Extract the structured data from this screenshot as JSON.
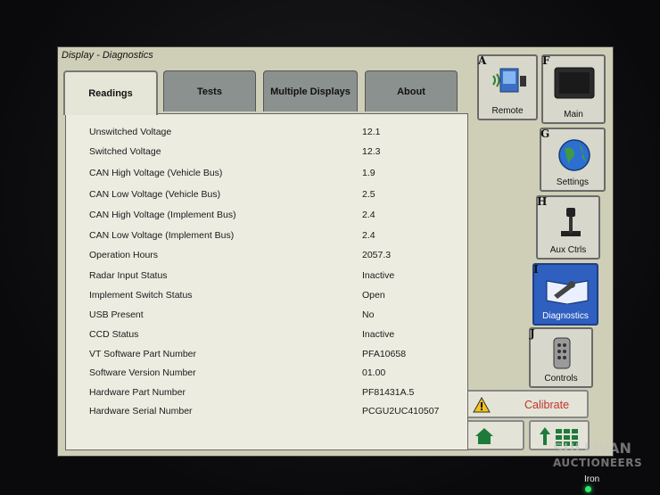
{
  "window": {
    "title": "Display - Diagnostics"
  },
  "tabs": [
    {
      "label": "Readings",
      "active": true
    },
    {
      "label": "Tests",
      "active": false
    },
    {
      "label": "Multiple Displays",
      "active": false
    },
    {
      "label": "About",
      "active": false
    }
  ],
  "readings": [
    {
      "label": "Unswitched Voltage",
      "value": "12.1"
    },
    {
      "label": "Switched Voltage",
      "value": "12.3"
    },
    {
      "label": "CAN High Voltage (Vehicle Bus)",
      "value": "1.9"
    },
    {
      "label": "CAN Low Voltage (Vehicle Bus)",
      "value": "2.5"
    },
    {
      "label": "CAN High Voltage (Implement Bus)",
      "value": "2.4"
    },
    {
      "label": "CAN Low Voltage (Implement Bus)",
      "value": "2.4"
    },
    {
      "label": "Operation Hours",
      "value": "2057.3"
    },
    {
      "label": "Radar Input Status",
      "value": "Inactive"
    },
    {
      "label": "Implement Switch Status",
      "value": "Open"
    },
    {
      "label": "USB Present",
      "value": "No"
    },
    {
      "label": "CCD Status",
      "value": "Inactive"
    },
    {
      "label": "VT Software Part Number",
      "value": "PFA10658"
    },
    {
      "label": "Software Version Number",
      "value": "01.00"
    },
    {
      "label": "Hardware Part Number",
      "value": "PF81431A.5"
    },
    {
      "label": "Hardware Serial Number",
      "value": "PCGU2UC410507"
    }
  ],
  "side_buttons": {
    "remote": {
      "key": "A",
      "label": "Remote",
      "icon": "remote-display-icon"
    },
    "main": {
      "key": "F",
      "label": "Main",
      "icon": "monitor-icon"
    },
    "settings": {
      "key": "G",
      "label": "Settings",
      "icon": "globe-icon"
    },
    "aux": {
      "key": "H",
      "label": "Aux Ctrls",
      "icon": "joystick-icon"
    },
    "diagnostics": {
      "key": "I",
      "label": "Diagnostics",
      "icon": "wrench-book-icon"
    },
    "controls": {
      "key": "J",
      "label": "Controls",
      "icon": "remote-control-icon"
    }
  },
  "bottom_buttons": {
    "calibrate": {
      "label": "Calibrate",
      "icon": "warning-icon"
    },
    "home": {
      "icon": "home-icon"
    },
    "menu": {
      "icon": "menu-grid-icon"
    }
  },
  "watermark": {
    "line1": "SULLIVAN",
    "line2": "AUCTIONEERS"
  },
  "device": {
    "label": "Iron"
  },
  "colors": {
    "screen_bg": "#cfcfb8",
    "tab_inactive": "#8b918e",
    "selected_button": "#2f5fbf",
    "calibrate_text": "#c2342a",
    "led": "#2ee86a"
  }
}
